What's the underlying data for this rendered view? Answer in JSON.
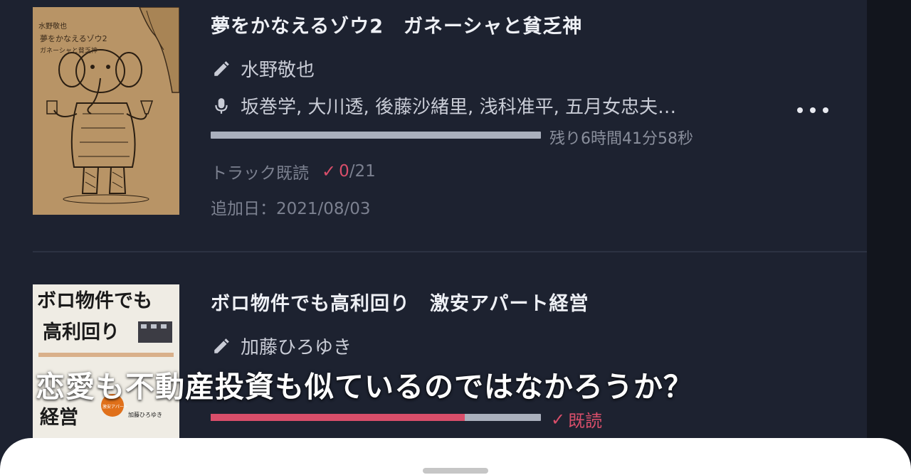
{
  "colors": {
    "background": "#1d2230",
    "accent": "#d94e6a",
    "progress_track": "#aab0bd",
    "muted_text": "#7c8190"
  },
  "books": [
    {
      "title": "夢をかなえるゾウ2　ガネーシャと貧乏神",
      "author": "水野敬也",
      "narrators": "坂巻学, 大川透, 後藤沙緒里, 浅科准平, 五月女忠夫…",
      "author_icon": "pencil-icon",
      "narrator_icon": "microphone-icon",
      "progress": 0.0,
      "remaining": "残り6時間41分58秒",
      "track_read_label": "トラック既読",
      "track_read_done": "0",
      "track_read_total": "/21",
      "added_date": "追加日：2021/08/03",
      "cover": {
        "top_line": "水野敬也",
        "title_line": "夢をかなえるゾウ2",
        "sub_line": "ガネーシャと貧乏神"
      }
    },
    {
      "title": "ボロ物件でも高利回り　激安アパート経営",
      "author": "加藤ひろゆき",
      "author_icon": "pencil-icon",
      "progress": 0.77,
      "status": "既読",
      "cover": {
        "line1": "ボロ物件でも",
        "line2": "高利回り",
        "line3": "経営",
        "badge": "激安アパート",
        "author_small": "加藤ひろゆき"
      }
    }
  ],
  "caption": "恋愛も不動産投資も似ているのではなかろうか？"
}
